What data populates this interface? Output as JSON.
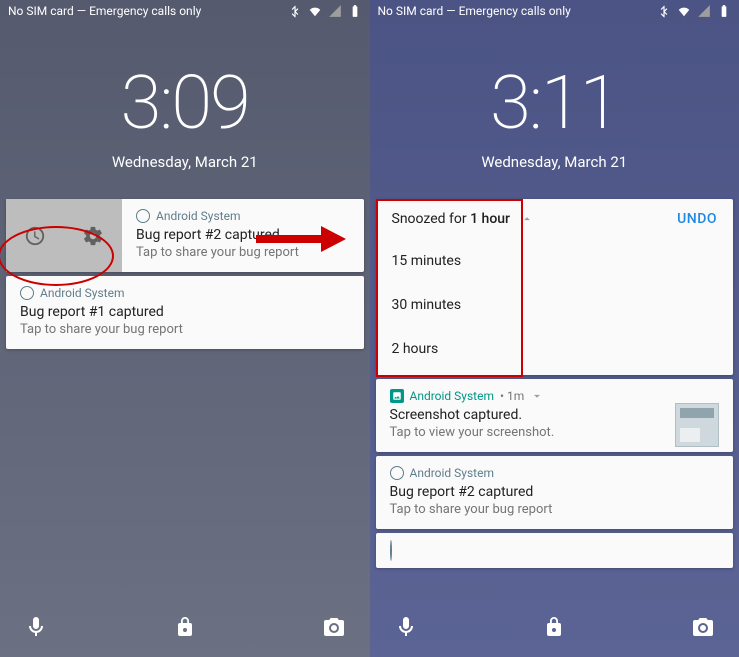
{
  "left": {
    "status": {
      "text": "No SIM card — Emergency calls only"
    },
    "clock": "3:09",
    "date": "Wednesday, March 21",
    "notif_revealed": {
      "app": "Android System",
      "title": "Bug report #2 captured",
      "sub": "Tap to share your bug report"
    },
    "notif2": {
      "app": "Android System",
      "title": "Bug report #1 captured",
      "sub": "Tap to share your bug report"
    }
  },
  "right": {
    "status": {
      "text": "No SIM card — Emergency calls only"
    },
    "clock": "3:11",
    "date": "Wednesday, March 21",
    "snooze": {
      "label_prefix": "Snoozed for ",
      "label_bold": "1 hour",
      "undo": "UNDO",
      "options": [
        "15 minutes",
        "30 minutes",
        "2 hours"
      ]
    },
    "notif_ss": {
      "app": "Android System",
      "time": "1m",
      "title": "Screenshot captured.",
      "sub": "Tap to view your screenshot."
    },
    "notif_bug": {
      "app": "Android System",
      "title": "Bug report #2 captured",
      "sub": "Tap to share your bug report"
    }
  }
}
